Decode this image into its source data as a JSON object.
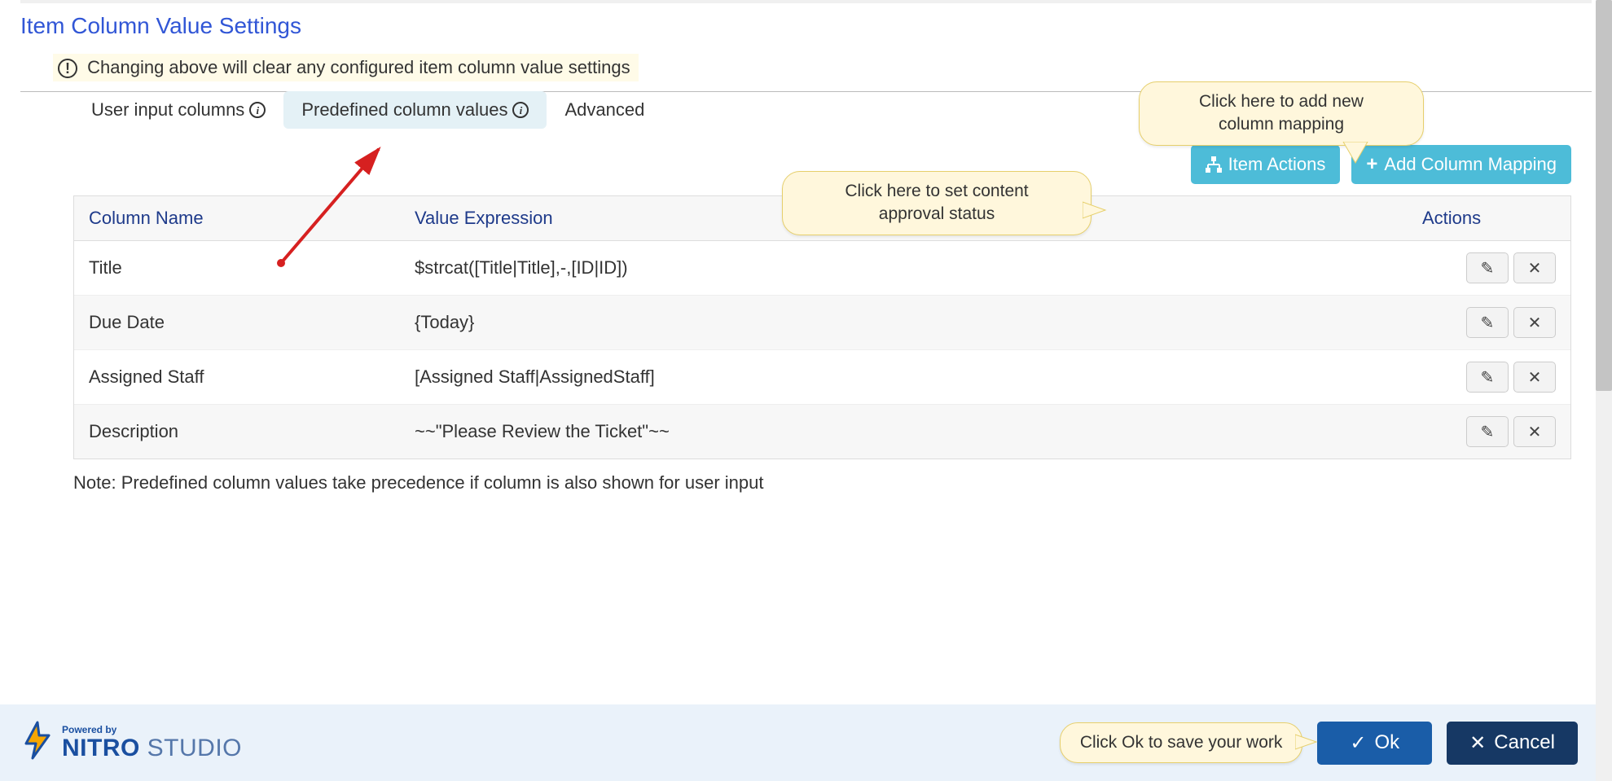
{
  "title": "Item Column Value Settings",
  "warning_text": "Changing above will clear any configured item column value settings",
  "tabs": {
    "user_input": "User input columns",
    "predefined": "Predefined column values",
    "advanced": "Advanced"
  },
  "callouts": {
    "approval": "Click here to set content\napproval status",
    "add_mapping": "Click here to add new\ncolumn mapping",
    "save": "Click Ok to save your work"
  },
  "buttons": {
    "item_actions": "Item Actions",
    "add_mapping": "Add Column Mapping",
    "ok": "Ok",
    "cancel": "Cancel"
  },
  "table": {
    "headers": {
      "name": "Column Name",
      "value": "Value Expression",
      "actions": "Actions"
    },
    "rows": [
      {
        "name": "Title",
        "value": "$strcat([Title|Title],-,[ID|ID])"
      },
      {
        "name": "Due Date",
        "value": "{Today}"
      },
      {
        "name": "Assigned Staff",
        "value": "[Assigned Staff|AssignedStaff]"
      },
      {
        "name": "Description",
        "value": "~~\"Please Review the Ticket\"~~"
      }
    ]
  },
  "note": "Note: Predefined column values take precedence if column is also shown for user input",
  "logo": {
    "powered_by": "Powered by",
    "brand1": "NITRO",
    "brand2": " STUDIO"
  }
}
